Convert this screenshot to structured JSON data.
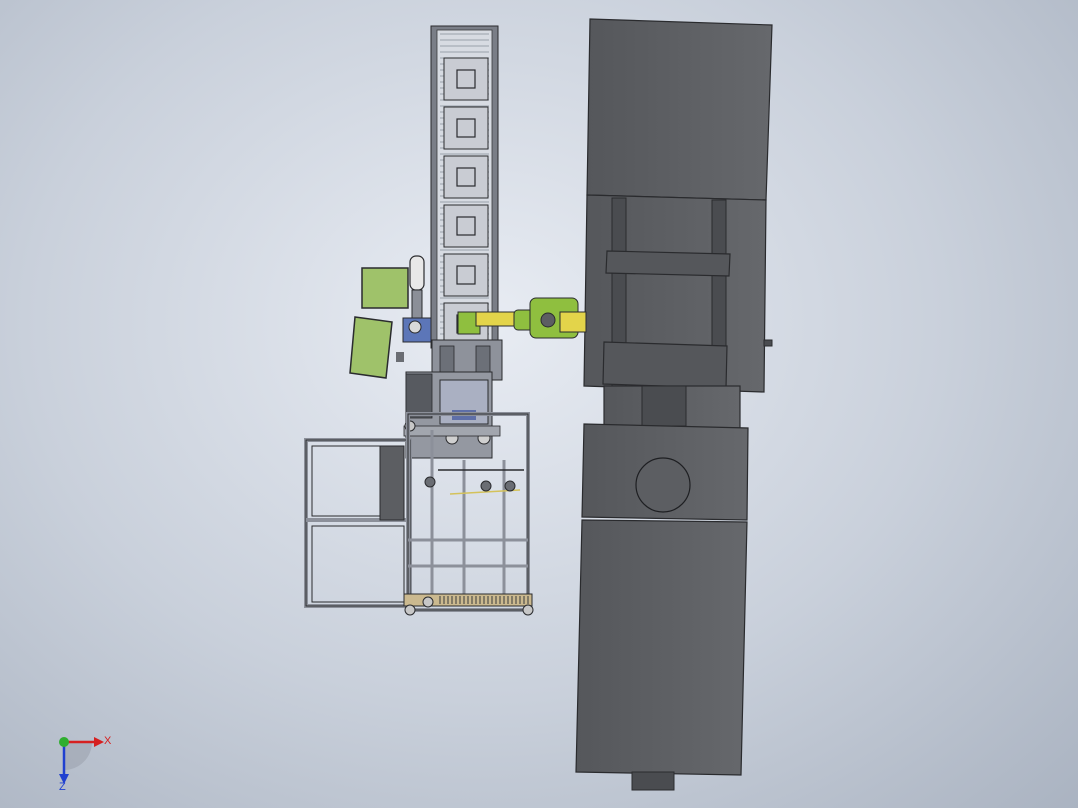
{
  "viewport": {
    "background_top": "#e8ecf3",
    "background_bottom": "#aab3c1"
  },
  "colors": {
    "machine_body": "#5c5e62",
    "machine_edge": "#2a2b2e",
    "frame": "#8c909a",
    "robot_green": "#8fbf3f",
    "robot_yellow": "#e3d44a",
    "screen_green": "#9fc26a",
    "axis_x": "#d62020",
    "axis_y": "#2fae2f",
    "axis_z": "#2040d0"
  },
  "conveyor": {
    "pallet_count": 6
  },
  "triad": {
    "x_label": "X",
    "z_label": "Z",
    "x_icon": "axis-x-arrow-icon",
    "y_icon": "axis-y-arrow-icon",
    "z_icon": "axis-z-arrow-icon"
  }
}
